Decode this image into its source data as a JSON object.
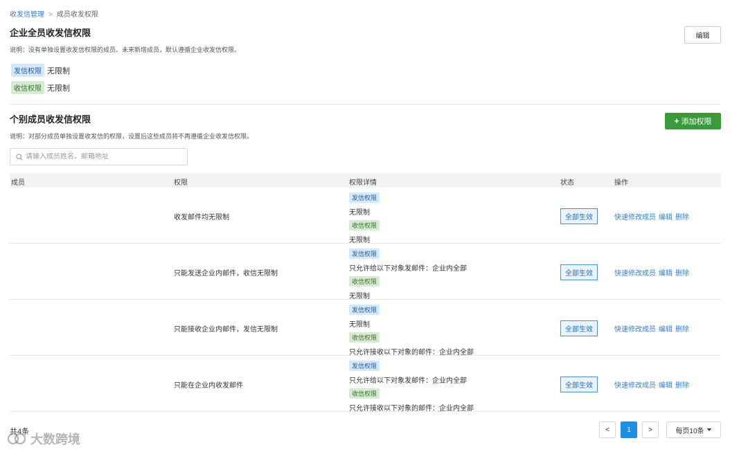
{
  "breadcrumb": {
    "parent": "收发信管理",
    "separator": ">",
    "current": "成员收发权限"
  },
  "section1": {
    "title": "企业全员收发信权限",
    "description": "说明：没有单独设置收发信权限的成员、未来新增成员，默认遵循企业收发信权限。",
    "edit_label": "编辑",
    "send": {
      "tag": "发信权限",
      "value": "无限制"
    },
    "receive": {
      "tag": "收信权限",
      "value": "无限制"
    }
  },
  "section2": {
    "title": "个别成员收发信权限",
    "description": "说明：对部分成员单独设置收发信的权限，设置后这些成员将不再遵循企业收发信权限。",
    "add_label": "添加权限",
    "search_placeholder": "请输入成员姓名、邮箱地址"
  },
  "table": {
    "headers": {
      "member": "成员",
      "permission": "权限",
      "details": "权限详情",
      "status": "状态",
      "ops": "操作"
    },
    "rows": [
      {
        "member": "",
        "permission": "收发邮件均无限制",
        "send_tag": "发信权限",
        "send_detail": "无限制",
        "recv_tag": "收信权限",
        "recv_detail": "无限制",
        "status": "全部生效",
        "op1": "快速修改成员",
        "op2": "编辑",
        "op3": "删除"
      },
      {
        "member": "",
        "permission": "只能发送企业内邮件，收信无限制",
        "send_tag": "发信权限",
        "send_detail": "只允许给以下对象发邮件：企业内全部",
        "recv_tag": "收信权限",
        "recv_detail": "无限制",
        "status": "全部生效",
        "op1": "快速修改成员",
        "op2": "编辑",
        "op3": "删除"
      },
      {
        "member": "",
        "permission": "只能接收企业内邮件，发信无限制",
        "send_tag": "发信权限",
        "send_detail": "无限制",
        "recv_tag": "收信权限",
        "recv_detail": "只允许接收以下对象的邮件：企业内全部",
        "status": "全部生效",
        "op1": "快速修改成员",
        "op2": "编辑",
        "op3": "删除"
      },
      {
        "member": "",
        "permission": "只能在企业内收发邮件",
        "send_tag": "发信权限",
        "send_detail": "只允许给以下对象发邮件：企业内全部",
        "recv_tag": "收信权限",
        "recv_detail": "只允许接收以下对象的邮件：企业内全部",
        "status": "全部生效",
        "op1": "快速修改成员",
        "op2": "编辑",
        "op3": "删除"
      }
    ]
  },
  "footer": {
    "total": "共4条",
    "prev": "<",
    "page": "1",
    "next": ">",
    "page_size": "每页10条",
    "page_size_icon": "caret-down-icon"
  },
  "watermark": {
    "text": "大数跨境"
  },
  "colors": {
    "primary": "#1e8fe6",
    "green_button": "#3a9a3a",
    "link": "#2f7fd6",
    "send_tag_bg": "#d4e8fb",
    "recv_tag_bg": "#d6ecd2"
  }
}
